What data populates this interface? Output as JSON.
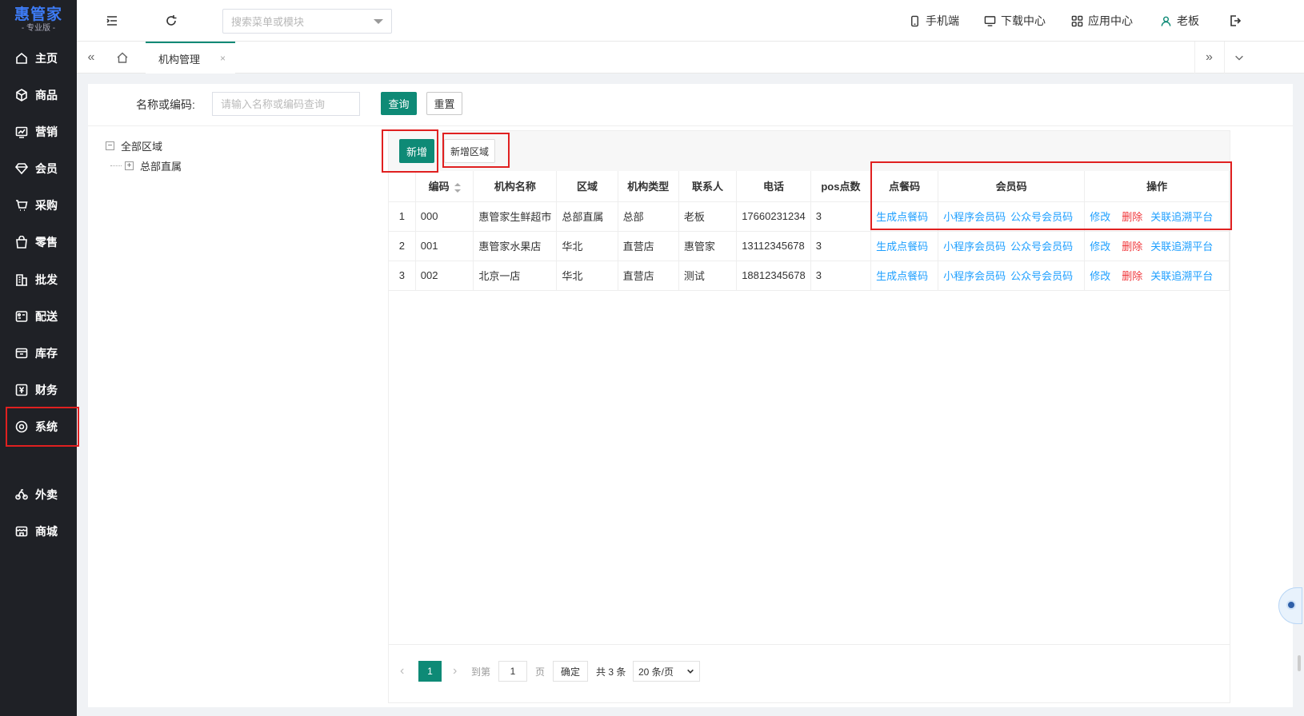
{
  "app": {
    "logo_main": "惠管家",
    "logo_sub": "- 专业版 -"
  },
  "sidebar": {
    "items": [
      {
        "label": "主页",
        "icon": "home-icon"
      },
      {
        "label": "商品",
        "icon": "cube-icon"
      },
      {
        "label": "营销",
        "icon": "chart-icon"
      },
      {
        "label": "会员",
        "icon": "diamond-icon"
      },
      {
        "label": "采购",
        "icon": "cart-icon"
      },
      {
        "label": "零售",
        "icon": "bag-icon"
      },
      {
        "label": "批发",
        "icon": "building-icon"
      },
      {
        "label": "配送",
        "icon": "truck-icon"
      },
      {
        "label": "库存",
        "icon": "inbox-icon"
      },
      {
        "label": "财务",
        "icon": "yen-icon"
      },
      {
        "label": "系统",
        "icon": "settings-icon"
      },
      {
        "label": "外卖",
        "icon": "bike-icon"
      },
      {
        "label": "商城",
        "icon": "store-icon"
      }
    ]
  },
  "topbar": {
    "search_placeholder": "搜索菜单或模块",
    "mobile": "手机端",
    "download": "下载中心",
    "apps": "应用中心",
    "user": "老板"
  },
  "tabs": {
    "active": "机构管理",
    "close": "×"
  },
  "filter": {
    "label": "名称或编码:",
    "placeholder": "请输入名称或编码查询",
    "query_btn": "查询",
    "reset_btn": "重置"
  },
  "tree": {
    "root": "全部区域",
    "root_toggle": "−",
    "child": "总部直属",
    "child_toggle": "+"
  },
  "toolbar": {
    "add_btn": "新增",
    "add_region_btn": "新增区域"
  },
  "table": {
    "headers": [
      "",
      "编码",
      "机构名称",
      "区域",
      "机构类型",
      "联系人",
      "电话",
      "pos点数",
      "点餐码",
      "会员码",
      "操作"
    ],
    "rows": [
      {
        "idx": "1",
        "code": "000",
        "name": "惠管家生鲜超市",
        "region": "总部直属",
        "type": "总部",
        "contact": "老板",
        "phone": "17660231234",
        "pos": "3"
      },
      {
        "idx": "2",
        "code": "001",
        "name": "惠管家水果店",
        "region": "华北",
        "type": "直营店",
        "contact": "惠管家",
        "phone": "13112345678",
        "pos": "3"
      },
      {
        "idx": "3",
        "code": "002",
        "name": "北京一店",
        "region": "华北",
        "type": "直营店",
        "contact": "测试",
        "phone": "18812345678",
        "pos": "3"
      }
    ],
    "link_order_code": "生成点餐码",
    "link_mini_code": "小程序会员码",
    "link_mp_code": "公众号会员码",
    "link_edit": "修改",
    "link_delete": "删除",
    "link_trace": "关联追溯平台"
  },
  "pager": {
    "prev": "‹",
    "next": "›",
    "current": "1",
    "goto_label": "到第",
    "goto_value": "1",
    "page_unit": "页",
    "confirm": "确定",
    "total": "共 3 条",
    "page_size": "20 条/页"
  },
  "colors": {
    "accent": "#0e8a76",
    "link": "#1e9fff",
    "danger": "#f0373b",
    "highlight_box": "#e02020"
  }
}
